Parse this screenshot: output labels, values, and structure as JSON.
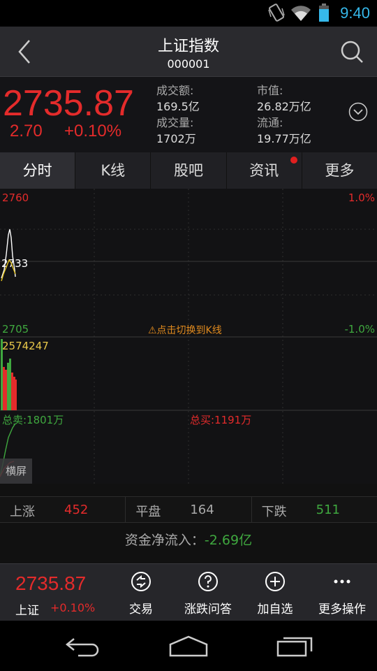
{
  "status_bar": {
    "time": "9:40"
  },
  "header": {
    "title": "上证指数",
    "code": "000001"
  },
  "quote": {
    "price": "2735.87",
    "change": "2.70",
    "change_pct": "+0.10%",
    "turnover_label": "成交额:",
    "turnover_value": "169.5亿",
    "volume_label": "成交量:",
    "volume_value": "1702万",
    "market_cap_label": "市值:",
    "market_cap_value": "26.82万亿",
    "float_label": "流通:",
    "float_value": "19.77万亿"
  },
  "tabs": [
    {
      "label": "分时",
      "active": true
    },
    {
      "label": "K线"
    },
    {
      "label": "股吧"
    },
    {
      "label": "资讯",
      "badge": true
    },
    {
      "label": "更多"
    }
  ],
  "chart": {
    "y_high": "2760",
    "y_mid": "2733",
    "y_low": "2705",
    "pct_high": "1.0%",
    "pct_low": "-1.0%",
    "switch_hint": "⚠点击切换到K线",
    "volume_max": "2574247",
    "total_sell": "总卖:1801万",
    "total_buy": "总买:1191万",
    "landscape_label": "横屏"
  },
  "market_breadth": {
    "up_label": "上涨",
    "up_value": "452",
    "flat_label": "平盘",
    "flat_value": "164",
    "down_label": "下跌",
    "down_value": "511"
  },
  "net_inflow": {
    "label": "资金净流入：",
    "value": "-2.69亿"
  },
  "bottom_bar": {
    "price": "2735.87",
    "name": "上证",
    "pct": "+0.10%",
    "actions": [
      {
        "label": "交易",
        "icon": "trade-icon"
      },
      {
        "label": "涨跌问答",
        "icon": "question-icon"
      },
      {
        "label": "加自选",
        "icon": "add-icon"
      },
      {
        "label": "更多操作",
        "icon": "more-icon"
      }
    ]
  },
  "colors": {
    "up": "#e42b2b",
    "down": "#3fa83f",
    "accent": "#36b8ea",
    "hint": "#e08a1e"
  }
}
